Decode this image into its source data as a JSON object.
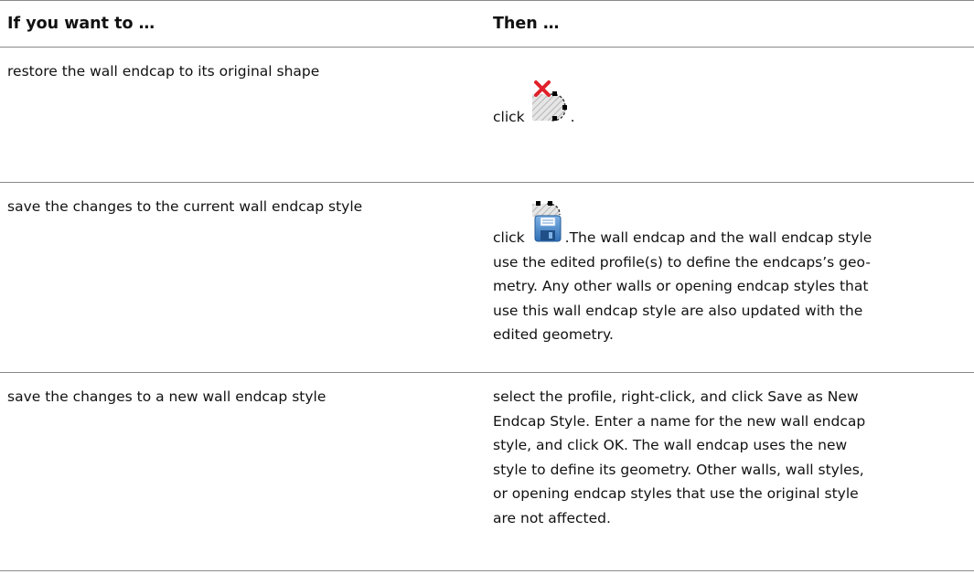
{
  "header": {
    "col1": "If you want to …",
    "col2": "Then …"
  },
  "rows": [
    {
      "want": "restore the wall endcap to its original shape",
      "then_prefix": "click",
      "then_suffix": ".",
      "icon": "restore-endcap-icon"
    },
    {
      "want": "save the changes to the current wall endcap style",
      "then_prefix": "click",
      "then_first_line": ".The wall endcap and the wall endcap style",
      "then_lines": [
        "use the edited profile(s) to define the endcaps’s geo-",
        "metry. Any other walls or opening endcap styles that",
        "use this wall endcap style are also updated with the",
        "edited geometry."
      ],
      "icon": "save-endcap-icon"
    },
    {
      "want": "save the changes to a new wall endcap style",
      "then_lines": [
        "select the profile, right-click, and click Save as New",
        "Endcap Style. Enter a name for the new wall endcap",
        "style, and click OK. The wall endcap uses the new",
        "style to define its geometry. Other walls, wall styles,",
        "or opening endcap styles that use the original style",
        "are not affected."
      ]
    }
  ]
}
